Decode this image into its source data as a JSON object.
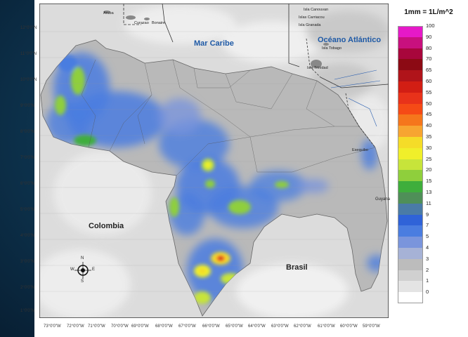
{
  "legend": {
    "title": "1mm = 1L/m^2",
    "items": [
      {
        "value": "100",
        "color": "#e619c8"
      },
      {
        "value": "90",
        "color": "#c8107e"
      },
      {
        "value": "80",
        "color": "#a8063c"
      },
      {
        "value": "70",
        "color": "#8c0a14"
      },
      {
        "value": "65",
        "color": "#b0141a"
      },
      {
        "value": "60",
        "color": "#d21e14"
      },
      {
        "value": "55",
        "color": "#e8321a"
      },
      {
        "value": "50",
        "color": "#f54a16"
      },
      {
        "value": "45",
        "color": "#f5761c"
      },
      {
        "value": "40",
        "color": "#f7a531"
      },
      {
        "value": "35",
        "color": "#f5dc28"
      },
      {
        "value": "30",
        "color": "#f0ef2a"
      },
      {
        "value": "25",
        "color": "#c7e43a"
      },
      {
        "value": "20",
        "color": "#8fcf3c"
      },
      {
        "value": "15",
        "color": "#3fae3c"
      },
      {
        "value": "13",
        "color": "#4f8f58"
      },
      {
        "value": "11",
        "color": "#4a7ba6"
      },
      {
        "value": "9",
        "color": "#2f63d8"
      },
      {
        "value": "7",
        "color": "#4a7de0"
      },
      {
        "value": "5",
        "color": "#7a95dc"
      },
      {
        "value": "4",
        "color": "#a6b2d6"
      },
      {
        "value": "3",
        "color": "#bcbcbc"
      },
      {
        "value": "2",
        "color": "#d0d0d0"
      },
      {
        "value": "1",
        "color": "#e4e4e4"
      },
      {
        "value": "0",
        "color": "#ffffff"
      }
    ]
  },
  "labels": {
    "mar_caribe": "Mar Caribe",
    "oceano_atlantico": "Océano Atlántico",
    "colombia": "Colombia",
    "brasil": "Brasil",
    "guyana": "Guyana",
    "aruba": "Aruba",
    "curazao": "Curazao",
    "bonaire": "Bonaire",
    "isla_canouvan": "Isla Canouvan",
    "islas_carriacou": "Islas Carriacou",
    "isla_granada": "Isla Granada",
    "isla_tobago": "Isla Tobago",
    "isla_trinidad": "Isla Trinidad",
    "esequibo": "Esequibo"
  },
  "lat_ticks": [
    "12°0'0\"N",
    "11°0'0\"N",
    "10°0'0\"N",
    "9°0'0\"N",
    "8°0'0\"N",
    "7°0'0\"N",
    "6°0'0\"N",
    "5°0'0\"N",
    "4°0'0\"N",
    "3°0'0\"N",
    "2°0'0\"N",
    "1°0'0\"N"
  ],
  "lon_ticks": [
    "73°0'0\"W",
    "72°0'0\"W",
    "71°0'0\"W",
    "70°0'0\"W",
    "69°0'0\"W",
    "68°0'0\"W",
    "67°0'0\"W",
    "66°0'0\"W",
    "65°0'0\"W",
    "64°0'0\"W",
    "63°0'0\"W",
    "62°0'0\"W",
    "61°0'0\"W",
    "60°0'0\"W",
    "59°0'0\"W"
  ],
  "compass": {
    "n": "N",
    "s": "S",
    "e": "E",
    "w": "W"
  }
}
